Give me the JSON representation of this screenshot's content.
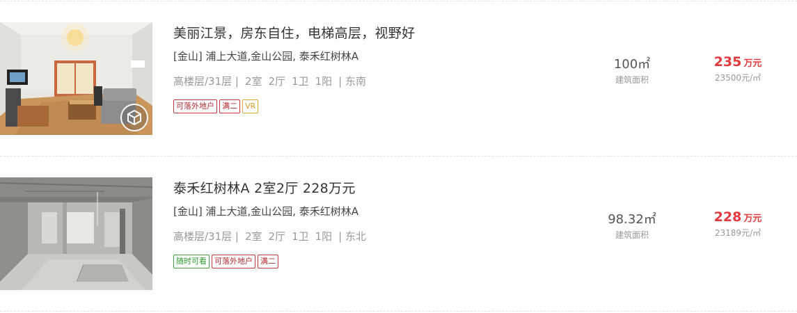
{
  "listings": [
    {
      "title": "美丽江景，房东自住，电梯高层，视野好",
      "address": "[金山] 浦上大道,金山公园, 泰禾红树林A",
      "attrs": [
        "高楼层/31层 |",
        "2室",
        "2厅",
        "1卫",
        "1阳",
        "| 东南"
      ],
      "tags": [
        {
          "text": "可落外地户",
          "color": "red"
        },
        {
          "text": "满二",
          "color": "red"
        },
        {
          "text": "VR",
          "color": "gold"
        }
      ],
      "area": "100㎡",
      "area_label": "建筑面积",
      "price": "235",
      "price_unit": "万元",
      "unit_price": "23500元/㎡",
      "has_vr": true,
      "image": "furnished-living-room-photo"
    },
    {
      "title": "泰禾红树林A 2室2厅 228万元",
      "address": "[金山] 浦上大道,金山公园, 泰禾红树林A",
      "attrs": [
        "高楼层/31层 |",
        "2室",
        "2厅",
        "1卫",
        "1阳",
        "| 东北"
      ],
      "tags": [
        {
          "text": "随时可看",
          "color": "green"
        },
        {
          "text": "可落外地户",
          "color": "red"
        },
        {
          "text": "满二",
          "color": "red"
        }
      ],
      "area": "98.32㎡",
      "area_label": "建筑面积",
      "price": "228",
      "price_unit": "万元",
      "unit_price": "23189元/㎡",
      "has_vr": false,
      "image": "unfinished-concrete-room-photo"
    }
  ],
  "colors": {
    "price_red": "#e4393c",
    "tag_red": "#b0292e",
    "tag_green": "#2c9a2c",
    "tag_gold": "#d99a2b"
  }
}
